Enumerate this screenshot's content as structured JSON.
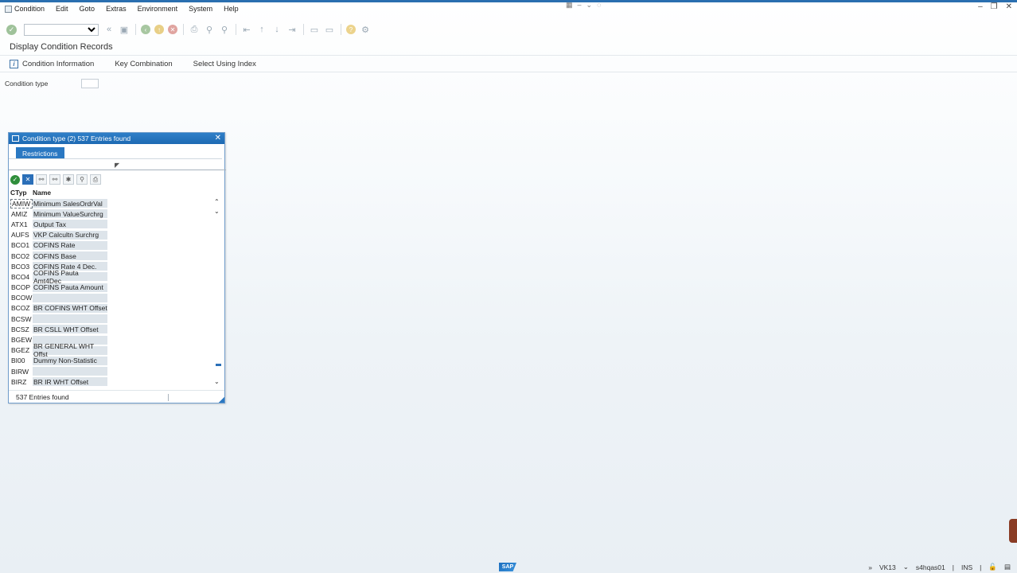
{
  "menu": {
    "items": [
      {
        "label": "Condition"
      },
      {
        "label": "Edit"
      },
      {
        "label": "Goto"
      },
      {
        "label": "Extras"
      },
      {
        "label": "Environment"
      },
      {
        "label": "System"
      },
      {
        "label": "Help"
      }
    ]
  },
  "toolbar": {
    "command_field_value": ""
  },
  "page": {
    "title": "Display Condition Records"
  },
  "app_toolbar": {
    "condition_information": "Condition Information",
    "key_combination": "Key Combination",
    "select_using_index": "Select Using Index"
  },
  "form": {
    "condition_type_label": "Condition type",
    "condition_type_value": ""
  },
  "dialog": {
    "title": "Condition type (2)  537 Entries found",
    "tab_restrictions": "Restrictions",
    "columns": {
      "ctyp": "CTyp",
      "name": "Name"
    },
    "rows": [
      {
        "ctyp": "AMIW",
        "name": "Minimum SalesOrdrVal"
      },
      {
        "ctyp": "AMIZ",
        "name": "Minimum ValueSurchrg"
      },
      {
        "ctyp": "ATX1",
        "name": "Output Tax"
      },
      {
        "ctyp": "AUFS",
        "name": "VKP Calcultn Surchrg"
      },
      {
        "ctyp": "BCO1",
        "name": "COFINS Rate"
      },
      {
        "ctyp": "BCO2",
        "name": "COFINS Base"
      },
      {
        "ctyp": "BCO3",
        "name": "COFINS Rate 4 Dec."
      },
      {
        "ctyp": "BCO4",
        "name": "COFINS Pauta Amt4Dec"
      },
      {
        "ctyp": "BCOP",
        "name": "COFINS Pauta Amount"
      },
      {
        "ctyp": "BCOW",
        "name": ""
      },
      {
        "ctyp": "BCOZ",
        "name": "BR COFINS WHT Offset"
      },
      {
        "ctyp": "BCSW",
        "name": ""
      },
      {
        "ctyp": "BCSZ",
        "name": "BR CSLL WHT Offset"
      },
      {
        "ctyp": "BGEW",
        "name": ""
      },
      {
        "ctyp": "BGEZ",
        "name": "BR GENERAL WHT Offst"
      },
      {
        "ctyp": "BI00",
        "name": "Dummy Non-Statistic"
      },
      {
        "ctyp": "BIRW",
        "name": ""
      },
      {
        "ctyp": "BIRZ",
        "name": "BR IR WHT Offset"
      }
    ],
    "footer_text": "537 Entries found"
  },
  "status": {
    "sap_logo": "SAP",
    "transaction": "VK13",
    "server": "s4hqas01",
    "mode": "INS"
  }
}
